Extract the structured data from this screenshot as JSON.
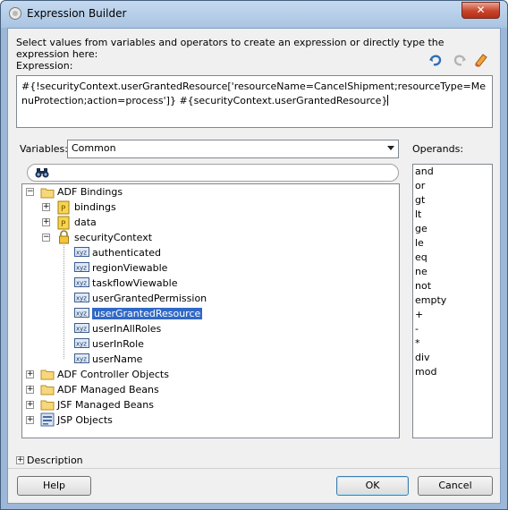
{
  "window": {
    "title": "Expression Builder",
    "close_glyph": "✕"
  },
  "instruction": "Select values from variables and operators to create an expression or directly type the expression here:",
  "expression": {
    "label": "Expression:",
    "value": "#{!securityContext.userGrantedResource['resourceName=CancelShipment;resourceType=MenuProtection;action=process']} #{securityContext.userGrantedResource}"
  },
  "toolbar": {
    "icons": [
      "undo-icon",
      "redo-icon",
      "clear-icon"
    ]
  },
  "variables": {
    "label": "Variables:",
    "selected": "Common",
    "search_placeholder": "",
    "tree": {
      "adf_bindings": "ADF Bindings",
      "bindings": "bindings",
      "data": "data",
      "security_context": "securityContext",
      "members": [
        "authenticated",
        "regionViewable",
        "taskflowViewable",
        "userGrantedPermission",
        "userGrantedResource",
        "userInAllRoles",
        "userInRole",
        "userName"
      ],
      "selected_member": "userGrantedResource",
      "adf_controller": "ADF Controller Objects",
      "adf_managed_beans": "ADF Managed Beans",
      "jsf_managed_beans": "JSF Managed Beans",
      "jsp_objects": "JSP Objects"
    }
  },
  "operands": {
    "label": "Operands:",
    "items": [
      "and",
      "or",
      "gt",
      "lt",
      "ge",
      "le",
      "eq",
      "ne",
      "not",
      "empty",
      "+",
      "-",
      "*",
      "div",
      "mod"
    ]
  },
  "description": {
    "label": "Description",
    "collapsed_glyph": "+"
  },
  "buttons": {
    "help": "Help",
    "ok": "OK",
    "cancel": "Cancel"
  }
}
